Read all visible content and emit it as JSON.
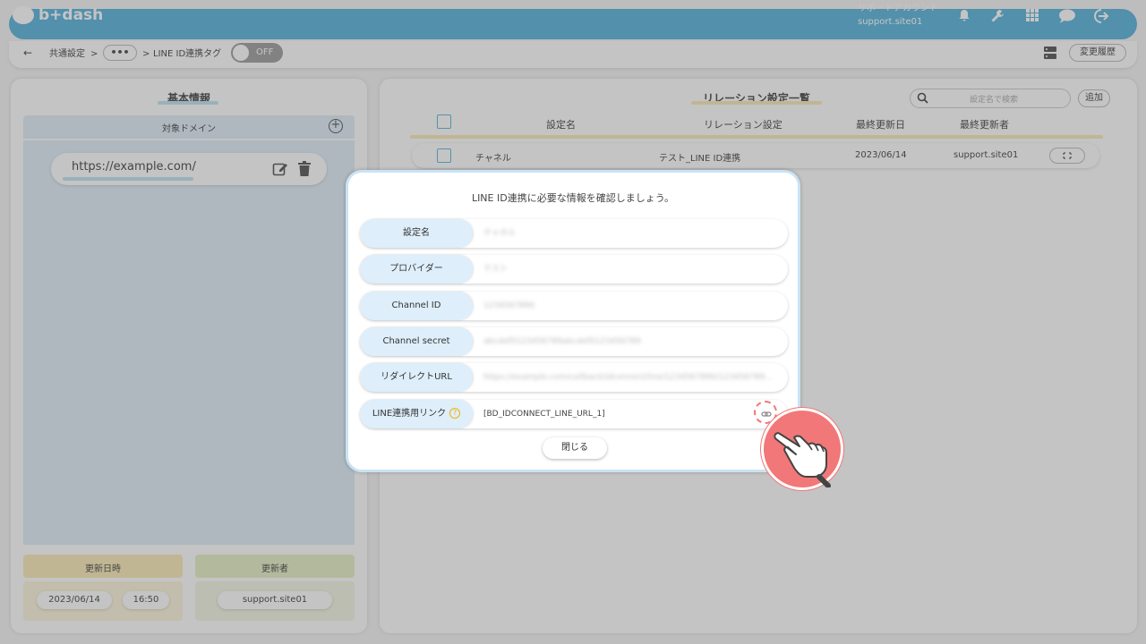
{
  "app": {
    "logo_text": "b+dash"
  },
  "header": {
    "account_name": "サポートアカウント",
    "account_id": "support.site01",
    "icons": [
      "bell-icon",
      "wrench-icon",
      "grid-icon",
      "chat-icon",
      "logout-icon"
    ]
  },
  "breadcrumb": {
    "items": [
      "共通設定",
      "LINE ID連携タグ"
    ],
    "separator": ">",
    "ellipsis": "•••",
    "toggle_label": "OFF"
  },
  "toolbar": {
    "history_label": "変更履歴"
  },
  "left_panel": {
    "title": "基本情報",
    "domain_header": "対象ドメイン",
    "domain_value": "https://example.com/",
    "updated_label": "更新日時",
    "updated_date": "2023/06/14",
    "updated_time": "16:50",
    "updater_label": "更新者",
    "updater_value": "support.site01"
  },
  "right_panel": {
    "title": "リレーション設定一覧",
    "search_placeholder": "設定名で検索",
    "add_label": "追加",
    "columns": [
      "設定名",
      "リレーション設定",
      "最終更新日",
      "最終更新者"
    ],
    "rows": [
      {
        "name": "チャネル",
        "relation": "テスト_LINE ID連携",
        "date": "2023/06/14",
        "user": "support.site01"
      }
    ]
  },
  "modal": {
    "title": "LINE ID連携に必要な情報を確認しましょう。",
    "fields": [
      {
        "label": "設定名",
        "value": "チャネル"
      },
      {
        "label": "プロバイダー",
        "value": "テスト"
      },
      {
        "label": "Channel ID",
        "value": "1234567890"
      },
      {
        "label": "Channel secret",
        "value": "abcdef0123456789abcdef0123456789"
      },
      {
        "label": "リダイレクトURL",
        "value": "https://example.com/callback/idconnect/line/1234567890/1234567890/abcdef..."
      },
      {
        "label": "LINE連携用リンク",
        "value": "[BD_IDCONNECT_LINE_URL_1]"
      }
    ],
    "help_glyph": "?",
    "close_label": "閉じる"
  }
}
